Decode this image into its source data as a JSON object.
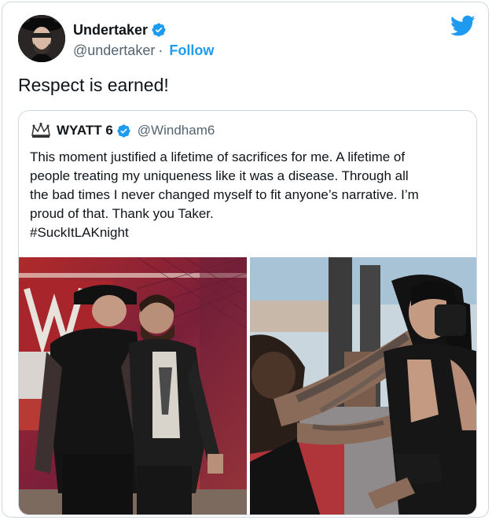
{
  "tweet": {
    "author": {
      "display_name": "Undertaker",
      "handle": "@undertaker",
      "separator": "·",
      "follow_label": "Follow",
      "verified": true
    },
    "text": "Respect is earned!",
    "brand_icon": "twitter-bird-icon",
    "colors": {
      "accent": "#1d9bf0",
      "text": "#0f1419",
      "muted": "#536471",
      "border": "#cfd9de"
    }
  },
  "quoted_tweet": {
    "author": {
      "display_name": "WYATT 6",
      "handle": "@Windham6",
      "verified": true
    },
    "text_lines": [
      "This moment justified a lifetime of sacrifices for me. A lifetime of",
      "people treating my uniqueness like it was a disease. Through all",
      "the bad times I never changed myself to fit anyone’s narrative. I’m",
      "proud of that. Thank you Taker.",
      "#SuckItLAKnight"
    ],
    "media": [
      {
        "name": "wrestlers-facing-photo"
      },
      {
        "name": "wrestlers-grappling-photo"
      }
    ]
  }
}
